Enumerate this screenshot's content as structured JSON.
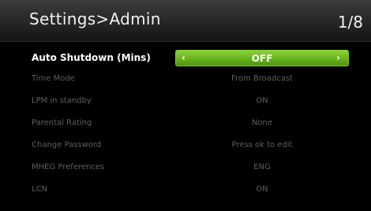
{
  "header": {
    "title": "Settings>Admin",
    "page": "1/8"
  },
  "settings": [
    {
      "label": "Auto Shutdown (Mins)",
      "value": "OFF",
      "selected": true
    },
    {
      "label": "Time Mode",
      "value": "From Broadcast"
    },
    {
      "label": "LPM in standby",
      "value": "ON"
    },
    {
      "label": "Parental Rating",
      "value": "None"
    },
    {
      "label": "Change Password",
      "value": "Press ok to edit"
    },
    {
      "label": "MHEG Preferences",
      "value": "ENG"
    },
    {
      "label": "LCN",
      "value": "ON"
    }
  ],
  "selector": {
    "left_icon": "chevron-left-icon",
    "right_icon": "chevron-right-icon",
    "left_glyph": "‹",
    "right_glyph": "›"
  },
  "colors": {
    "accent_green": "#6bb51f",
    "background": "#000000",
    "header_bg": "#2a2a2a",
    "dim_text": "#5e5e5e",
    "bright_text": "#ffffff"
  }
}
